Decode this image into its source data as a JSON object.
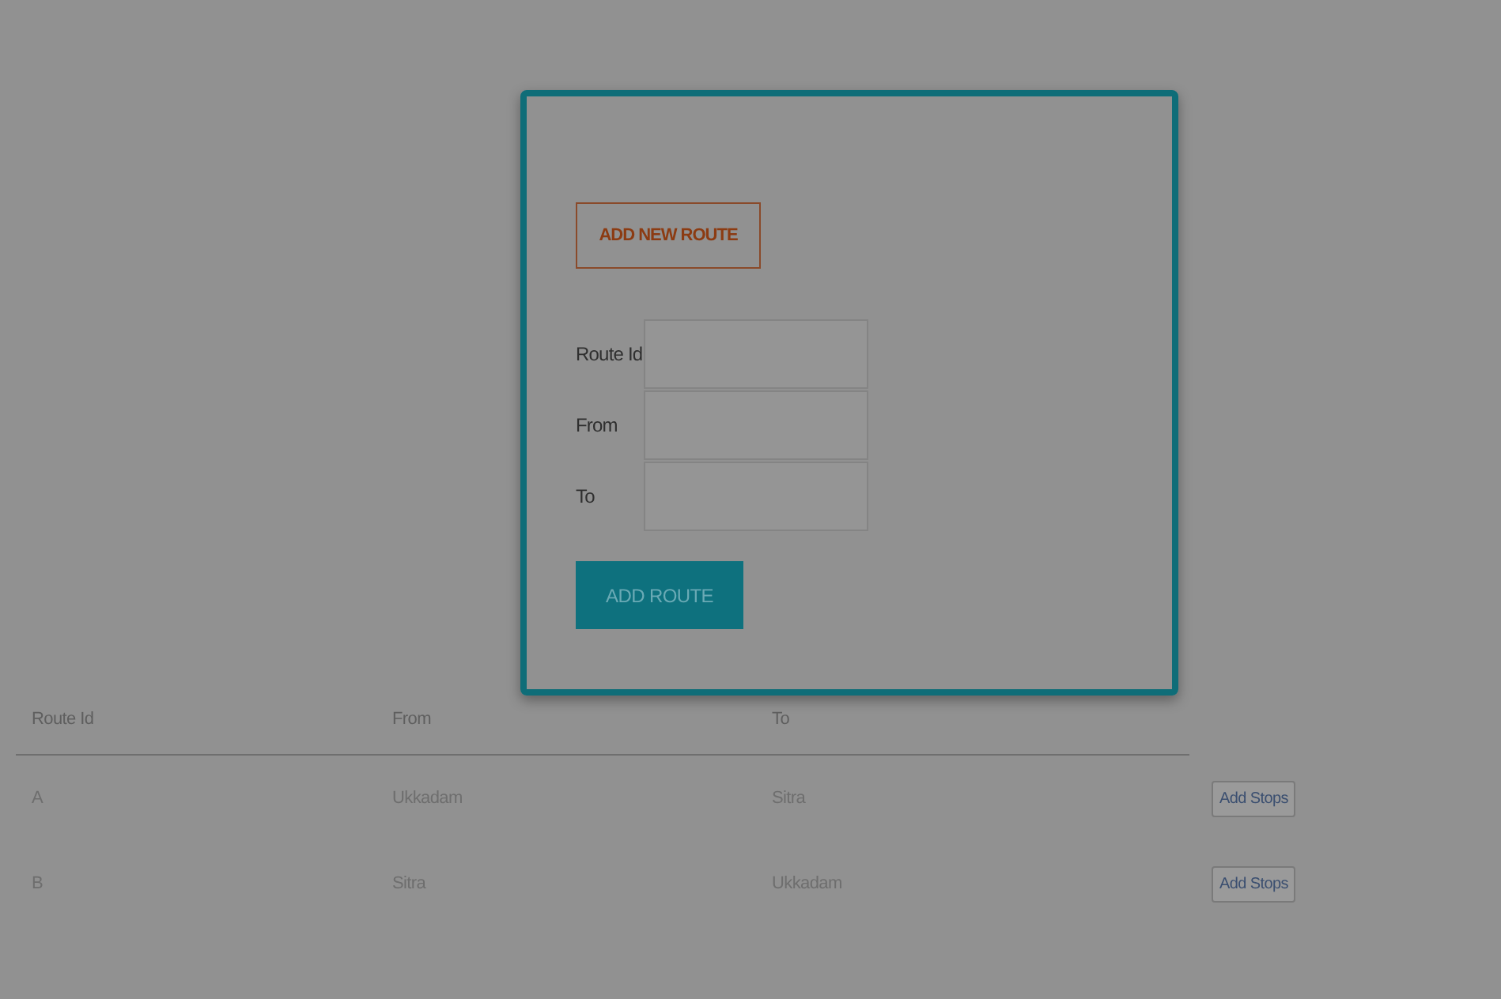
{
  "dialog": {
    "title_button": "ADD NEW ROUTE",
    "fields": [
      {
        "label": "Route Id"
      },
      {
        "label": "From"
      },
      {
        "label": "To"
      }
    ],
    "submit_button": "ADD ROUTE"
  },
  "table": {
    "columns": [
      "Route Id",
      "From",
      "To"
    ],
    "rows": [
      {
        "cells": [
          "A",
          "Ukkadam",
          "Sitra"
        ],
        "action": "Add Stops"
      },
      {
        "cells": [
          "B",
          "Sitra",
          "Ukkadam"
        ],
        "action": "Add Stops"
      }
    ]
  }
}
